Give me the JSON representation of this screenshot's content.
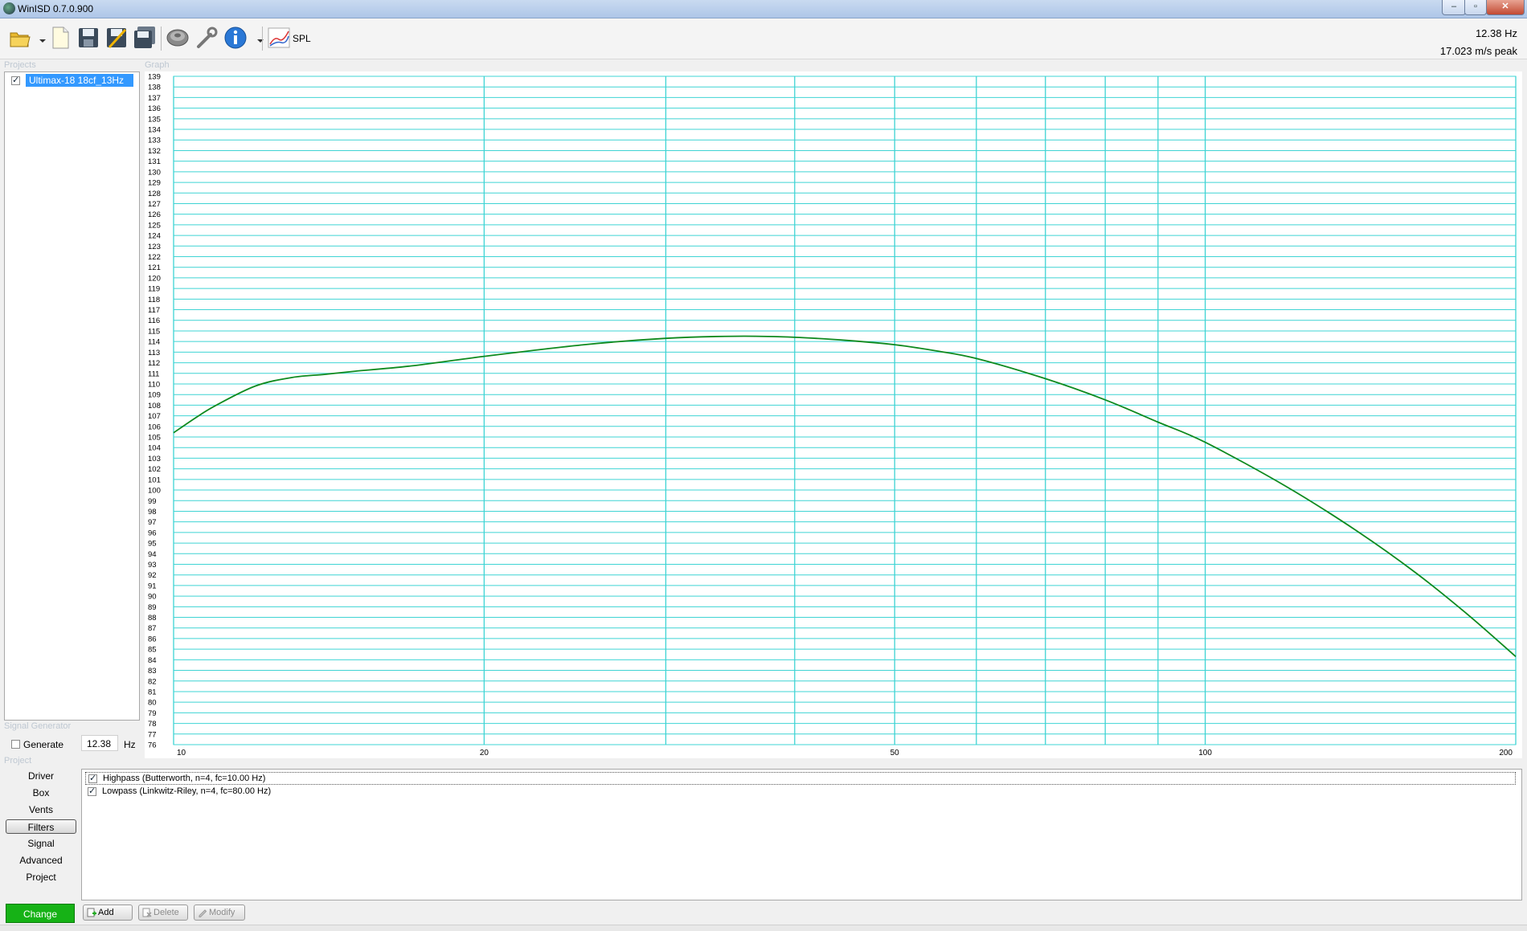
{
  "window": {
    "title": "WinISD 0.7.0.900",
    "controls": [
      "–",
      "▫",
      "✕"
    ]
  },
  "toolbar": {
    "buttons": [
      "open-icon",
      "new-icon",
      "save-icon",
      "save-as-icon",
      "save-all-icon",
      "driver-icon",
      "tools-icon",
      "info-icon",
      "spl-graph-icon"
    ],
    "graph_label": "SPL"
  },
  "readout": {
    "frequency": "12.38 Hz",
    "value": "17.023 m/s peak"
  },
  "projects": {
    "label": "Projects",
    "items": [
      {
        "name": "Ultimax-18 18cf_13Hz",
        "checked": true,
        "selected": true
      }
    ]
  },
  "graph": {
    "label": "Graph"
  },
  "signal_generator": {
    "label": "Signal Generator",
    "generate_label": "Generate",
    "generate_checked": false,
    "frequency_value": "12.38",
    "unit": "Hz"
  },
  "project_nav": {
    "label": "Project",
    "items": [
      "Driver",
      "Box",
      "Vents",
      "Filters",
      "Signal",
      "Advanced",
      "Project"
    ],
    "active": "Filters",
    "change_label": "Change"
  },
  "filters": {
    "rows": [
      {
        "label": "Highpass (Butterworth, n=4, fc=10.00 Hz)",
        "checked": true
      },
      {
        "label": "Lowpass (Linkwitz-Riley, n=4, fc=80.00 Hz)",
        "checked": true
      }
    ],
    "buttons": {
      "add": "Add",
      "delete": "Delete",
      "modify": "Modify"
    }
  },
  "colors": {
    "grid": "#3fd4d4",
    "curve": "#0f8a1e",
    "selection": "#3399ff",
    "change_button": "#16b216"
  },
  "chart_data": {
    "type": "line",
    "xscale": "log",
    "xlim": [
      10,
      200
    ],
    "ylim": [
      76,
      139
    ],
    "x_ticks": [
      10,
      20,
      50,
      100,
      200
    ],
    "x_gridlines": [
      10,
      20,
      30,
      40,
      50,
      60,
      70,
      80,
      90,
      100,
      200
    ],
    "y_ticks_step": 1,
    "grid": true,
    "series": [
      {
        "x": [
          10,
          10.5,
          11,
          12,
          13,
          14,
          15,
          17,
          20,
          25,
          30,
          35,
          40,
          45,
          50,
          55,
          60,
          70,
          80,
          90,
          100,
          120,
          140,
          160,
          180,
          200
        ],
        "values": [
          105.4,
          106.8,
          108.0,
          109.8,
          110.6,
          110.9,
          111.2,
          111.7,
          112.6,
          113.7,
          114.3,
          114.5,
          114.4,
          114.1,
          113.7,
          113.1,
          112.4,
          110.5,
          108.5,
          106.4,
          104.5,
          100.3,
          96.2,
          92.2,
          88.2,
          84.3
        ]
      }
    ]
  }
}
